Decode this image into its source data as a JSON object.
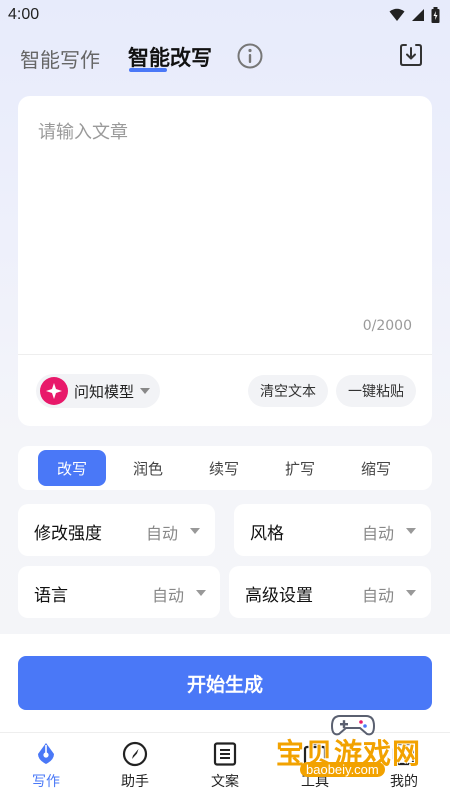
{
  "status_bar": {
    "time": "4:00"
  },
  "header": {
    "tabs": [
      {
        "label": "智能写作",
        "active": false
      },
      {
        "label": "智能改写",
        "active": true
      }
    ]
  },
  "editor": {
    "placeholder": "请输入文章",
    "value": "",
    "char_count": "0/2000",
    "model_label": "问知模型",
    "clear_label": "清空文本",
    "paste_label": "一键粘贴"
  },
  "modes": {
    "items": [
      {
        "label": "改写",
        "active": true
      },
      {
        "label": "润色",
        "active": false
      },
      {
        "label": "续写",
        "active": false
      },
      {
        "label": "扩写",
        "active": false
      },
      {
        "label": "缩写",
        "active": false
      }
    ]
  },
  "options": {
    "strength": {
      "label": "修改强度",
      "value": "自动"
    },
    "style": {
      "label": "风格",
      "value": "自动"
    },
    "language": {
      "label": "语言",
      "value": "自动"
    },
    "advanced": {
      "label": "高级设置",
      "value": "自动"
    }
  },
  "generate_label": "开始生成",
  "nav": {
    "items": [
      {
        "label": "写作",
        "icon": "pen-nib-icon",
        "active": true
      },
      {
        "label": "助手",
        "icon": "compass-icon",
        "active": false
      },
      {
        "label": "文案",
        "icon": "document-icon",
        "active": false
      },
      {
        "label": "工具",
        "icon": "toolbox-icon",
        "active": false
      },
      {
        "label": "我的",
        "icon": "profile-icon",
        "active": false
      }
    ]
  },
  "watermark": {
    "main": "宝贝游戏网",
    "sub": "baobeiy.com"
  },
  "colors": {
    "accent": "#4a78f7",
    "model_logo": "#e8196a",
    "watermark": "#f2a200"
  }
}
